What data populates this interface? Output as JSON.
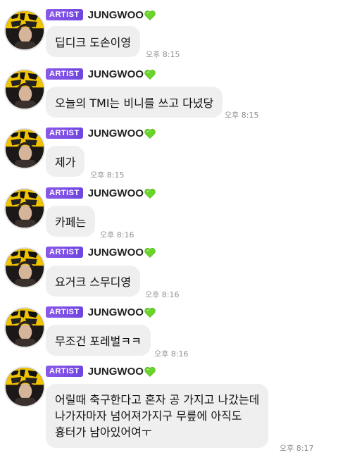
{
  "artist": {
    "badge": "ARTIST",
    "name": "JUNGWOO",
    "heart_icon": "green-heart-icon",
    "heart_color": "#6bd42a",
    "badge_color": "#7b4fe4",
    "avatar_icon": "artist-avatar-photo",
    "avatar_text": "英雄"
  },
  "colors": {
    "bubble": "#efefef",
    "timestamp": "#8f8f8f"
  },
  "messages": [
    {
      "text": "딥디크 도손이영",
      "time": "오후 8:15"
    },
    {
      "text": "오늘의 TMI는 비니를 쓰고 다녔당",
      "time": "오후 8:15"
    },
    {
      "text": "제가",
      "time": "오후 8:15"
    },
    {
      "text": "카페는",
      "time": "오후 8:16"
    },
    {
      "text": "요거크 스무디영",
      "time": "오후 8:16"
    },
    {
      "text": "무조건 포레벌ㅋㅋ",
      "time": "오후 8:16"
    },
    {
      "lines": [
        "어릴때 축구한다고 혼자 공 가지고 나갔는데",
        "나가자마자 넘어져가지구 무릎에 아직도",
        "흉터가 남아있어여ㅜ"
      ],
      "time": "오후 8:17"
    }
  ]
}
